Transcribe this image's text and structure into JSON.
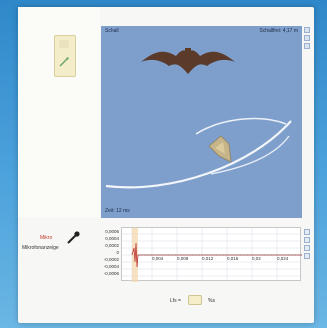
{
  "sim": {
    "title": "Schall",
    "right_label": "Schallfrei: 4,17 m",
    "time_label": "Zeit: 12 ms"
  },
  "microphone": {
    "top_label": "Mikro",
    "label": "Mikrofonanzeige"
  },
  "plot": {
    "y_ticks": [
      "0,0006",
      "0,0004",
      "0,0002",
      "0",
      "-0,0002",
      "-0,0004",
      "-0,0006"
    ],
    "x_ticks": [
      "0,004",
      "0,008",
      "0,012",
      "0,016",
      "0,02",
      "0,024"
    ]
  },
  "speed": {
    "label": "Lfs =",
    "unit": "%s"
  },
  "colors": {
    "background": "#2f88c9",
    "sim_bg": "#7e9fcb",
    "bat": "#5b3a2a",
    "moth": "#c6b48a",
    "wave": "#ffffff"
  }
}
